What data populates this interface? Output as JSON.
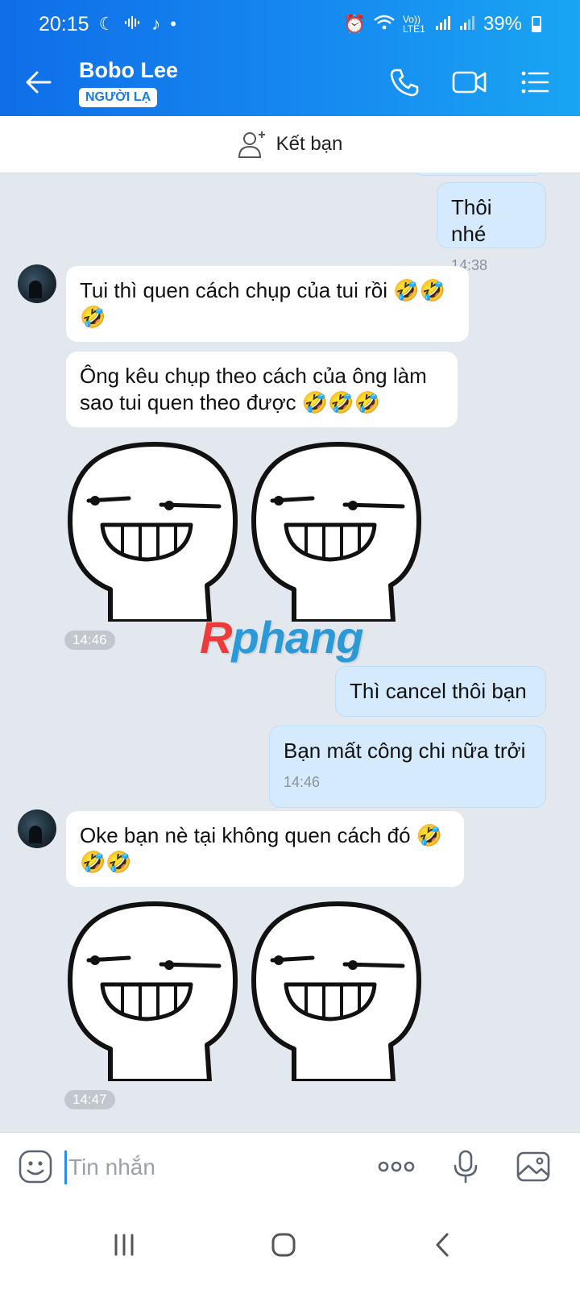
{
  "status_bar": {
    "time": "20:15",
    "battery": "39%",
    "network": "Vo)) LTE1"
  },
  "header": {
    "contact_name": "Bobo Lee",
    "badge": "NGƯỜI LẠ"
  },
  "add_friend": {
    "label": "Kết bạn"
  },
  "messages": {
    "m1": {
      "text": "Thôi nhé",
      "time": "14:38"
    },
    "m2": {
      "text": "Tui thì quen cách chụp của tui rồi 🤣🤣🤣"
    },
    "m3": {
      "text": "Ông kêu chụp theo cách của ông làm sao tui quen theo được 🤣🤣🤣"
    },
    "sticker1_time": "14:46",
    "m4": {
      "text": "Thì cancel thôi bạn"
    },
    "m5": {
      "text": "Bạn mất công chi nữa trởi",
      "time": "14:46"
    },
    "m6": {
      "text": "Oke bạn nè tại không quen cách đó 🤣🤣🤣"
    },
    "sticker2_time": "14:47"
  },
  "watermark": {
    "part1": "R",
    "part2": "phang"
  },
  "composer": {
    "placeholder": "Tin nhắn"
  },
  "icons": {
    "back": "arrow-left-icon",
    "call": "phone-icon",
    "video": "video-camera-icon",
    "menu": "list-menu-icon",
    "add_friend": "add-user-icon",
    "emoji": "emoji-icon",
    "more": "more-dots-icon",
    "mic": "microphone-icon",
    "image": "image-icon"
  },
  "colors": {
    "header_start": "#0f6ee8",
    "header_end": "#19a5f3",
    "outgoing_bubble": "#d5ebfd",
    "incoming_bubble": "#ffffff"
  }
}
